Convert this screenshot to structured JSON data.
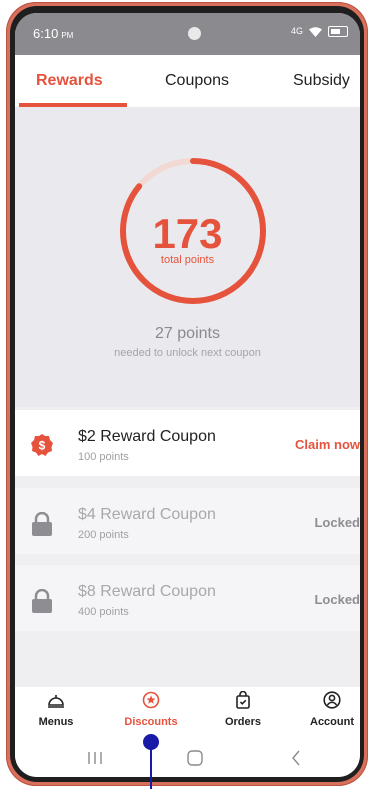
{
  "status_bar": {
    "time": "6:10",
    "ampm": "PM",
    "network": "4G"
  },
  "tabs": [
    {
      "label": "Rewards",
      "active": true
    },
    {
      "label": "Coupons",
      "active": false
    },
    {
      "label": "Subsidy",
      "active": false
    }
  ],
  "points": {
    "total": "173",
    "total_label": "total points",
    "needed": "27 points",
    "needed_label": "needed to unlock next coupon",
    "progress_fraction": 0.86
  },
  "coupons": [
    {
      "title": "$2 Reward Coupon",
      "points": "100 points",
      "action": "Claim now",
      "icon": "dollar-badge-icon",
      "locked": false
    },
    {
      "title": "$4 Reward Coupon",
      "points": "200 points",
      "action": "Locked",
      "icon": "lock-icon",
      "locked": true
    },
    {
      "title": "$8 Reward Coupon",
      "points": "400 points",
      "action": "Locked",
      "icon": "lock-icon",
      "locked": true
    }
  ],
  "bottom_nav": [
    {
      "label": "Menus",
      "icon": "bell-icon",
      "active": false
    },
    {
      "label": "Discounts",
      "icon": "star-badge-icon",
      "active": true
    },
    {
      "label": "Orders",
      "icon": "bag-icon",
      "active": false
    },
    {
      "label": "Account",
      "icon": "person-icon",
      "active": false
    }
  ],
  "colors": {
    "accent": "#e5533d",
    "ring_track": "#f3d9d4",
    "device_frame": "#d9705c"
  }
}
